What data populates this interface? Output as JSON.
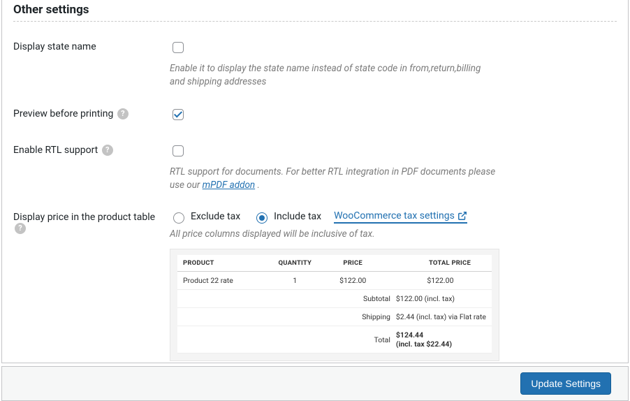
{
  "section_title": "Other settings",
  "fields": {
    "state_name": {
      "label": "Display state name",
      "checked": false,
      "desc": "Enable it to display the state name instead of state code in from,return,billing and shipping addresses"
    },
    "preview": {
      "label": "Preview before printing",
      "checked": true
    },
    "rtl": {
      "label": "Enable RTL support",
      "checked": false,
      "desc_prefix": "RTL support for documents. For better RTL integration in PDF documents please use our ",
      "link_text": "mPDF addon",
      "desc_suffix": " ."
    },
    "price_display": {
      "label": "Display price in the product table",
      "exclude": "Exclude tax",
      "include": "Include tax",
      "selected": "include",
      "settings_link": "WooCommerce tax settings",
      "desc": "All price columns displayed will be inclusive of tax."
    }
  },
  "preview_table": {
    "headers": {
      "product": "PRODUCT",
      "qty": "QUANTITY",
      "price": "PRICE",
      "total": "TOTAL PRICE"
    },
    "row": {
      "product": "Product 22 rate",
      "qty": "1",
      "price": "$122.00",
      "total": "$122.00"
    },
    "subtotal_label": "Subtotal",
    "subtotal_value": "$122.00 (incl. tax)",
    "shipping_label": "Shipping",
    "shipping_value": "$2.44 (incl. tax) via Flat rate",
    "grand_label": "Total",
    "grand_value1": "$124.44",
    "grand_value2": "(incl. tax $22.44)"
  },
  "save_button": "Update Settings"
}
